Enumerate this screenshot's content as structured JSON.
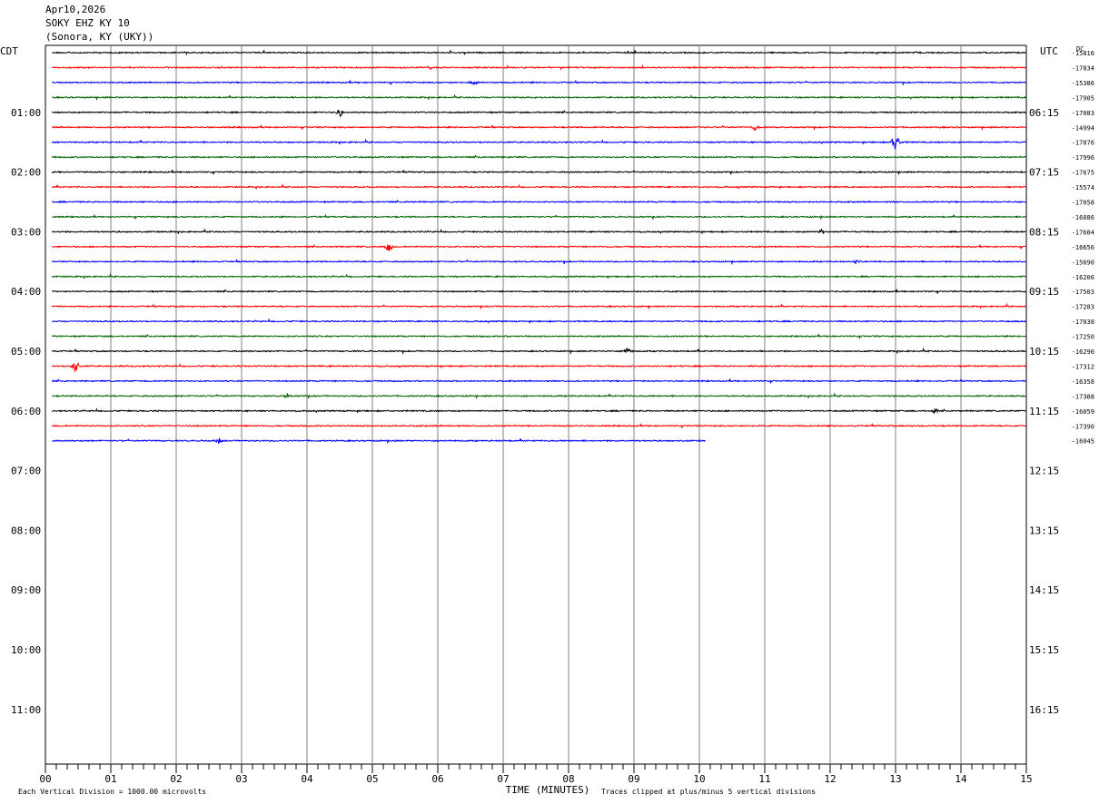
{
  "header": {
    "date": "Apr10,2026",
    "station": "SOKY EHZ KY 10",
    "location": "(Sonora, KY (UKY))"
  },
  "footer": {
    "scale_note": "Each Vertical Division = 1000.00 microvolts",
    "clip_note": "Traces clipped at plus/minus 5 vertical divisions"
  },
  "chart_data": {
    "type": "line",
    "title": "",
    "xlabel": "TIME (MINUTES)",
    "left_axis_label": "CDT",
    "right_axis_label": "UTC",
    "dc_label": "DC",
    "xlim": [
      0,
      15
    ],
    "x_ticks": [
      "00",
      "01",
      "02",
      "03",
      "04",
      "05",
      "06",
      "07",
      "08",
      "09",
      "10",
      "11",
      "12",
      "13",
      "14",
      "15"
    ],
    "minutes_per_row": 15,
    "rows_per_hour": 4,
    "total_rows": 48,
    "grid": true,
    "trace_colors": [
      "#000000",
      "#ff0000",
      "#0000ff",
      "#006400"
    ],
    "cdt_hour_labels": [
      "",
      "01:00",
      "02:00",
      "03:00",
      "04:00",
      "05:00",
      "06:00",
      "07:00",
      "08:00",
      "09:00",
      "10:00",
      "11:00"
    ],
    "utc_hour_labels": [
      "",
      "06:15",
      "07:15",
      "08:15",
      "09:15",
      "10:15",
      "11:15",
      "12:15",
      "13:15",
      "14:15",
      "15:15",
      "16:15"
    ],
    "dc_offsets": [
      "-15816",
      "-17834",
      "-15386",
      "-17905",
      "-17083",
      "-14994",
      "-17076",
      "-17996",
      "-17675",
      "-15574",
      "-17058",
      "-16086",
      "-17684",
      "-16656",
      "-15690",
      "-16206",
      "-17503",
      "-17283",
      "-17038",
      "-17250",
      "-16290",
      "-17312",
      "-16358",
      "-17388",
      "-16059",
      "-17390",
      "-16045"
    ],
    "last_row_end_minute": 10.1,
    "events": [
      {
        "row": 1,
        "minute": 5.85,
        "amp": 3
      },
      {
        "row": 2,
        "minute": 6.55,
        "amp": 2
      },
      {
        "row": 4,
        "minute": 4.5,
        "amp": 5
      },
      {
        "row": 5,
        "minute": 10.85,
        "amp": 3
      },
      {
        "row": 6,
        "minute": 13.0,
        "amp": 9
      },
      {
        "row": 12,
        "minute": 11.85,
        "amp": 4
      },
      {
        "row": 13,
        "minute": 5.25,
        "amp": 6
      },
      {
        "row": 14,
        "minute": 12.4,
        "amp": 3
      },
      {
        "row": 20,
        "minute": 8.9,
        "amp": 4
      },
      {
        "row": 21,
        "minute": 0.45,
        "amp": 7
      },
      {
        "row": 23,
        "minute": 3.7,
        "amp": 2
      },
      {
        "row": 24,
        "minute": 13.6,
        "amp": 3
      },
      {
        "row": 26,
        "minute": 2.65,
        "amp": 3
      }
    ]
  }
}
